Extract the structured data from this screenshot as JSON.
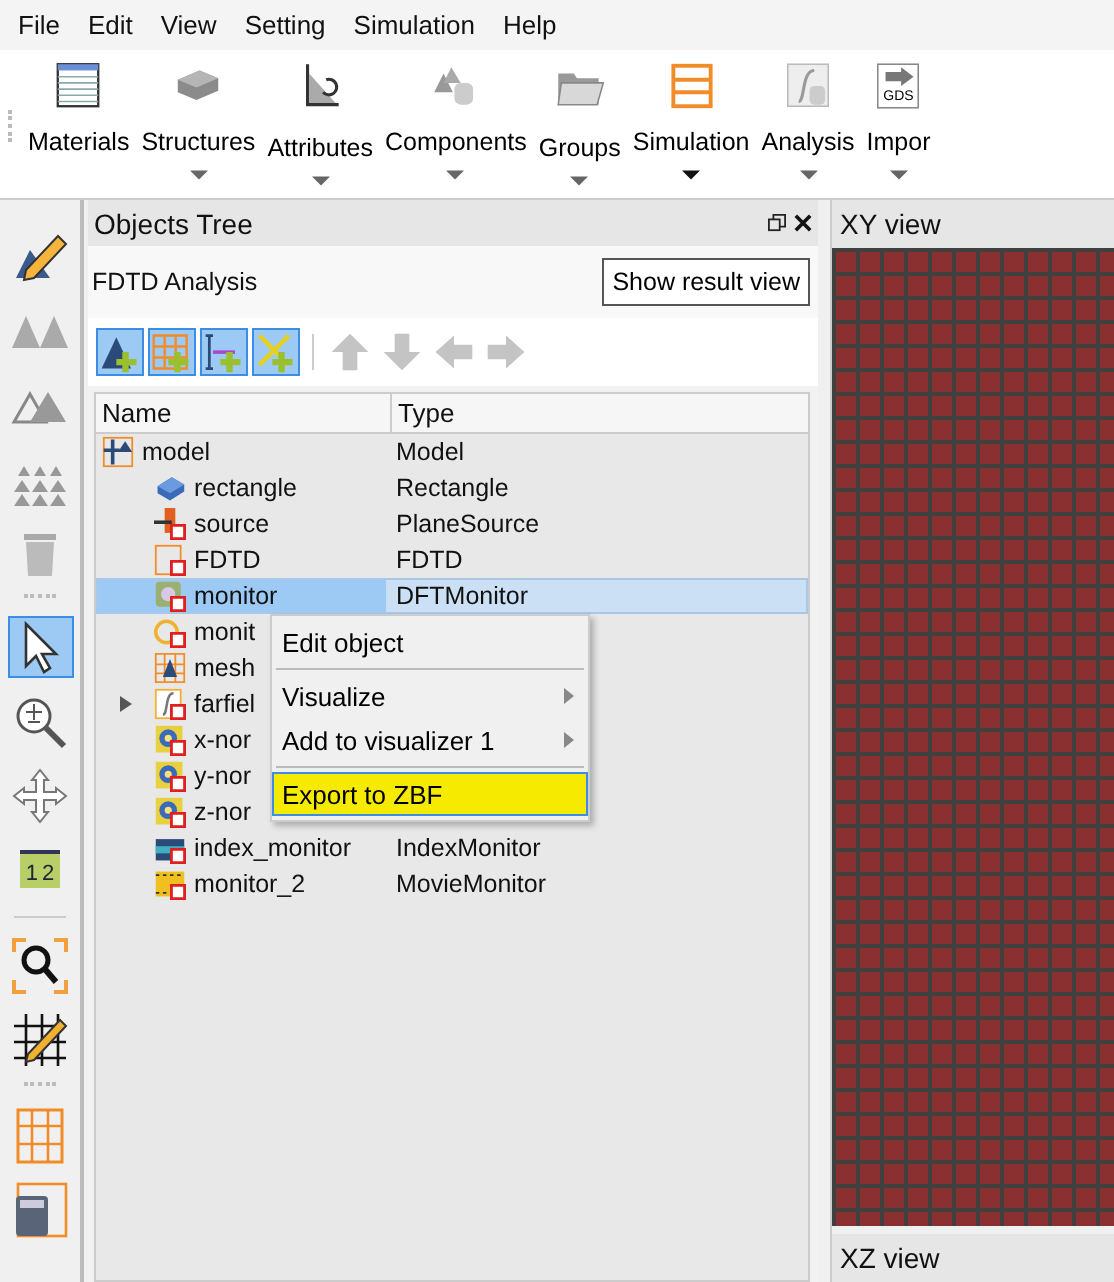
{
  "menu_bar": [
    {
      "label": "File"
    },
    {
      "label": "Edit"
    },
    {
      "label": "View"
    },
    {
      "label": "Setting"
    },
    {
      "label": "Simulation"
    },
    {
      "label": "Help"
    }
  ],
  "ribbon": [
    {
      "label": "Materials",
      "kind": "materials",
      "dropdown": false
    },
    {
      "label": "Structures",
      "kind": "structures",
      "dropdown": true
    },
    {
      "label": "Attributes",
      "kind": "attributes",
      "dropdown": true
    },
    {
      "label": "Components",
      "kind": "components",
      "dropdown": true
    },
    {
      "label": "Groups",
      "kind": "groups",
      "dropdown": true
    },
    {
      "label": "Simulation",
      "kind": "simulation",
      "dropdown": true
    },
    {
      "label": "Analysis",
      "kind": "analysis",
      "dropdown": true
    },
    {
      "label": "Impor",
      "kind": "import",
      "dropdown": true,
      "icon_text": "GDS"
    }
  ],
  "side_tools": [
    {
      "kind": "pencil",
      "selected": false
    },
    {
      "kind": "tri-small",
      "selected": false
    },
    {
      "kind": "tri-outline",
      "selected": false
    },
    {
      "kind": "pyramid",
      "selected": false
    },
    {
      "kind": "trash",
      "selected": false
    },
    {
      "kind": "grip"
    },
    {
      "kind": "pointer",
      "selected": true
    },
    {
      "kind": "zoom",
      "selected": false
    },
    {
      "kind": "move",
      "selected": false
    },
    {
      "kind": "ruler",
      "selected": false,
      "texts": [
        "1",
        "2"
      ]
    },
    {
      "kind": "sep"
    },
    {
      "kind": "zoom-frame",
      "selected": false
    },
    {
      "kind": "grid-pencil",
      "selected": false
    },
    {
      "kind": "grip"
    },
    {
      "kind": "grid",
      "selected": false
    },
    {
      "kind": "calc-grid",
      "selected": false
    }
  ],
  "objects_tree": {
    "title": "Objects Tree",
    "subtitle": "FDTD Analysis",
    "result_button": "Show result view",
    "tools": [
      {
        "kind": "add-structure",
        "disabled": false
      },
      {
        "kind": "add-mesh",
        "disabled": false
      },
      {
        "kind": "add-ruler",
        "disabled": false
      },
      {
        "kind": "add-cross",
        "disabled": false
      },
      {
        "kind": "up",
        "disabled": true
      },
      {
        "kind": "down",
        "disabled": true
      },
      {
        "kind": "left",
        "disabled": true
      },
      {
        "kind": "right",
        "disabled": true
      }
    ],
    "columns": [
      "Name",
      "Type"
    ],
    "rows": [
      {
        "name": "model",
        "type": "Model",
        "kind": "model",
        "selected": false,
        "children": [
          {
            "name": "rectangle",
            "type": "Rectangle",
            "kind": "rect",
            "selected": false
          },
          {
            "name": "source",
            "type": "PlaneSource",
            "kind": "source",
            "selected": false
          },
          {
            "name": "FDTD",
            "type": "FDTD",
            "kind": "fdtd",
            "selected": false
          },
          {
            "name": "monitor",
            "type": "DFTMonitor",
            "kind": "dft",
            "selected": true
          },
          {
            "name": "monit",
            "kind": "time",
            "selected": false
          },
          {
            "name": "mesh",
            "kind": "mesh",
            "selected": false
          },
          {
            "name": "farfiel",
            "kind": "func",
            "selected": false,
            "expanded": false
          },
          {
            "name": "x-nor",
            "kind": "norm",
            "selected": false
          },
          {
            "name": "y-nor",
            "kind": "norm",
            "selected": false
          },
          {
            "name": "z-nor",
            "kind": "norm",
            "selected": false
          },
          {
            "name": "index_monitor",
            "type": "IndexMonitor",
            "kind": "index",
            "selected": false
          },
          {
            "name": "monitor_2",
            "type": "MovieMonitor",
            "kind": "movie",
            "selected": false
          }
        ]
      }
    ]
  },
  "context_menu": [
    {
      "kind": "item",
      "label": "Edit object",
      "submenu": false,
      "selected": false
    },
    {
      "kind": "separator"
    },
    {
      "kind": "item",
      "label": "Visualize",
      "submenu": true,
      "selected": false
    },
    {
      "kind": "item",
      "label": "Add to visualizer 1",
      "submenu": true,
      "selected": false
    },
    {
      "kind": "separator"
    },
    {
      "kind": "item",
      "label": "Export to ZBF",
      "submenu": false,
      "selected": true
    }
  ],
  "views": [
    {
      "title": "XY view"
    },
    {
      "title": "XZ view"
    }
  ]
}
